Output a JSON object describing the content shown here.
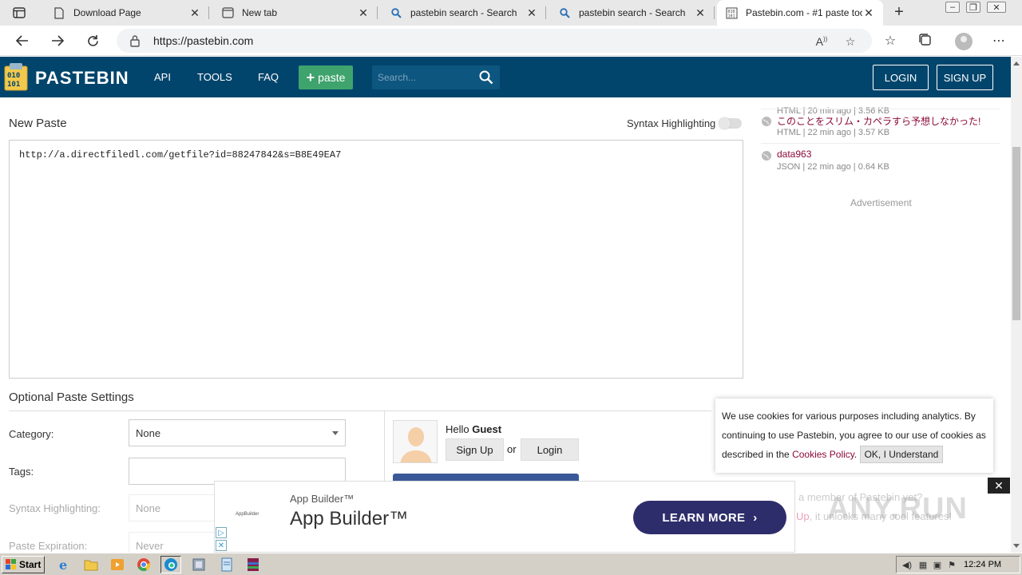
{
  "browser": {
    "tabs": [
      {
        "title": "Download Page"
      },
      {
        "title": "New tab"
      },
      {
        "title": "pastebin search - Search"
      },
      {
        "title": "pastebin search - Search"
      },
      {
        "title": "Pastebin.com - #1 paste tool"
      }
    ],
    "url": "https://pastebin.com"
  },
  "header": {
    "logo": "PASTEBIN",
    "nav": [
      "API",
      "TOOLS",
      "FAQ"
    ],
    "paste_button": "paste",
    "search_placeholder": "Search...",
    "login": "LOGIN",
    "signup": "SIGN UP"
  },
  "editor": {
    "title": "New Paste",
    "syntax_label": "Syntax Highlighting",
    "content": "http://a.directfiledl.com/getfile?id=88247842&s=B8E49EA7"
  },
  "settings": {
    "title": "Optional Paste Settings",
    "category_label": "Category:",
    "category_value": "None",
    "tags_label": "Tags:",
    "syntax_label": "Syntax Highlighting:",
    "syntax_value": "None",
    "expiration_label": "Paste Expiration:",
    "expiration_value": "Never"
  },
  "guest": {
    "hello": "Hello",
    "name": "Guest",
    "signup": "Sign Up",
    "or": "or",
    "login": "Login"
  },
  "sidebar": {
    "items": [
      {
        "title": "",
        "meta": "HTML | 20 min ago | 3.56 KB"
      },
      {
        "title": "このことをスリム・カペラすら予想しなかった!",
        "meta": "HTML | 22 min ago | 3.57 KB"
      },
      {
        "title": "data963",
        "meta": "JSON | 22 min ago | 0.64 KB"
      }
    ],
    "advertisement": "Advertisement",
    "bg_member_text": "a member of Pastebin yet?",
    "bg_signup_link": "Up",
    "bg_signup_rest": ", it unlocks many cool features!"
  },
  "cookie": {
    "text": "We use cookies for various purposes including analytics. By continuing to use Pastebin, you agree to our use of cookies as described in the",
    "link": "Cookies Policy",
    "period": ".",
    "button": "OK, I Understand"
  },
  "ad": {
    "brand_small": "App Builder™",
    "brand_big": "App Builder™",
    "logo_text": "AppBuilder",
    "cta": "LEARN MORE"
  },
  "watermark": "ANY.RUN",
  "taskbar": {
    "start": "Start",
    "clock": "12:24 PM"
  },
  "colors": {
    "header_bg": "#02456c",
    "paste_green": "#3fa36d",
    "link_maroon": "#8b0a3a",
    "ad_button": "#2e2d6b"
  }
}
